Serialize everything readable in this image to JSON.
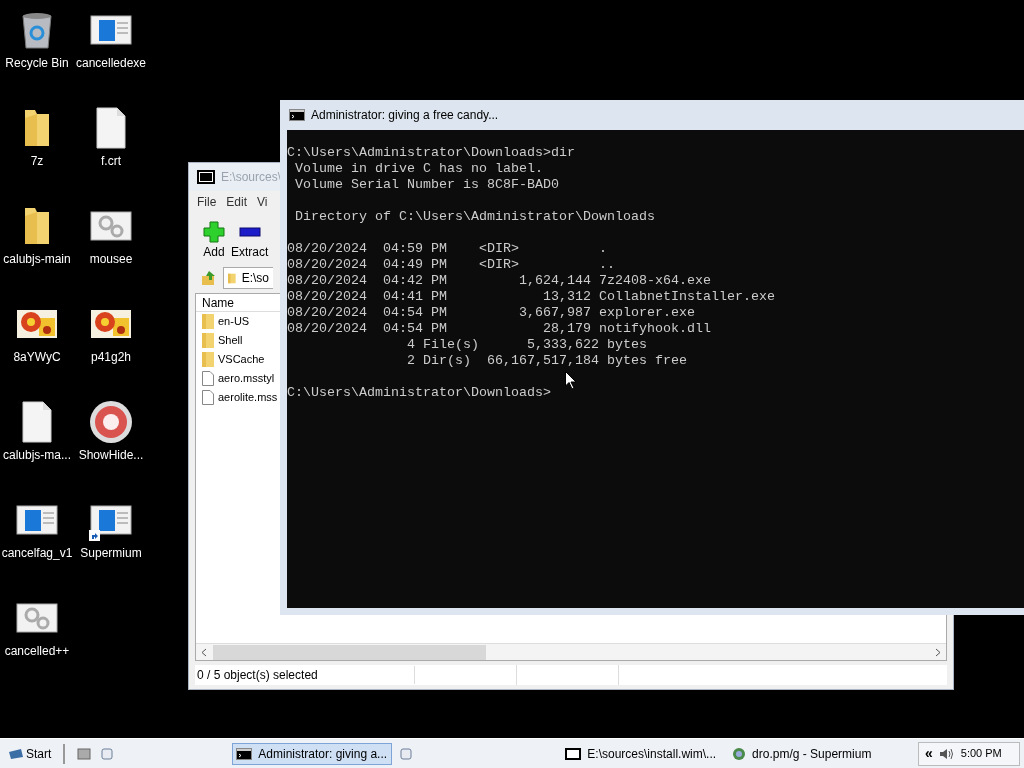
{
  "desktop_icons": [
    {
      "label": "Recycle Bin",
      "kind": "recycle",
      "shortcut": false
    },
    {
      "label": "7z",
      "kind": "folder",
      "shortcut": false
    },
    {
      "label": "calubjs-main",
      "kind": "folder",
      "shortcut": false
    },
    {
      "label": "8aYWyC",
      "kind": "photo",
      "shortcut": false
    },
    {
      "label": "calubjs-ma...",
      "kind": "file",
      "shortcut": false
    },
    {
      "label": "cancelfag_v1",
      "kind": "app",
      "shortcut": false
    },
    {
      "label": "cancelled++",
      "kind": "gears",
      "shortcut": false
    },
    {
      "label": "cancelledexe",
      "kind": "app",
      "shortcut": false
    },
    {
      "label": "f.crt",
      "kind": "file",
      "shortcut": false
    },
    {
      "label": "mousee",
      "kind": "gears",
      "shortcut": false
    },
    {
      "label": "p41g2h",
      "kind": "photo",
      "shortcut": false
    },
    {
      "label": "ShowHide...",
      "kind": "disc",
      "shortcut": false
    },
    {
      "label": "Supermium",
      "kind": "app",
      "shortcut": true
    }
  ],
  "archive_window": {
    "title": "E:\\sources\\",
    "menu": [
      "File",
      "Edit",
      "Vi"
    ],
    "toolbar": [
      {
        "label": "Add",
        "kind": "add"
      },
      {
        "label": "Extract",
        "kind": "extract"
      }
    ],
    "address": "E:\\so",
    "columns": [
      "Name"
    ],
    "rows": [
      {
        "name": "en-US",
        "kind": "folder"
      },
      {
        "name": "Shell",
        "kind": "folder"
      },
      {
        "name": "VSCache",
        "kind": "folder"
      },
      {
        "name": "aero.msstyl",
        "kind": "file"
      },
      {
        "name": "aerolite.mss",
        "kind": "file"
      }
    ],
    "status": [
      "0 / 5 object(s) selected"
    ]
  },
  "console_window": {
    "title": "Administrator:  giving a free candy...",
    "blocks": [
      {
        "lines": [
          "C:\\Users\\Administrator\\Downloads>dir",
          " Volume in drive C has no label.",
          " Volume Serial Number is 8C8F-BAD0"
        ]
      },
      {
        "lines": [
          " Directory of C:\\Users\\Administrator\\Downloads"
        ]
      },
      {
        "lines": [
          "08/20/2024  04:59 PM    <DIR>          .",
          "08/20/2024  04:49 PM    <DIR>          ..",
          "08/20/2024  04:42 PM         1,624,144 7z2408-x64.exe",
          "08/20/2024  04:41 PM            13,312 CollabnetInstaller.exe",
          "08/20/2024  04:54 PM         3,667,987 explorer.exe",
          "08/20/2024  04:54 PM            28,179 notifyhook.dll",
          "               4 File(s)      5,333,622 bytes",
          "               2 Dir(s)  66,167,517,184 bytes free"
        ]
      },
      {
        "lines": [
          "C:\\Users\\Administrator\\Downloads>"
        ]
      }
    ]
  },
  "taskbar": {
    "start": "Start",
    "tasks": [
      {
        "label": "Administrator:  giving a...",
        "kind": "console",
        "selected": true
      },
      {
        "label": "E:\\sources\\install.wim\\...",
        "kind": "archive",
        "selected": false
      },
      {
        "label": "dro.pm/g - Supermium",
        "kind": "browser",
        "selected": false
      }
    ],
    "tray_toggle": "«",
    "clock": "5:00 PM"
  }
}
